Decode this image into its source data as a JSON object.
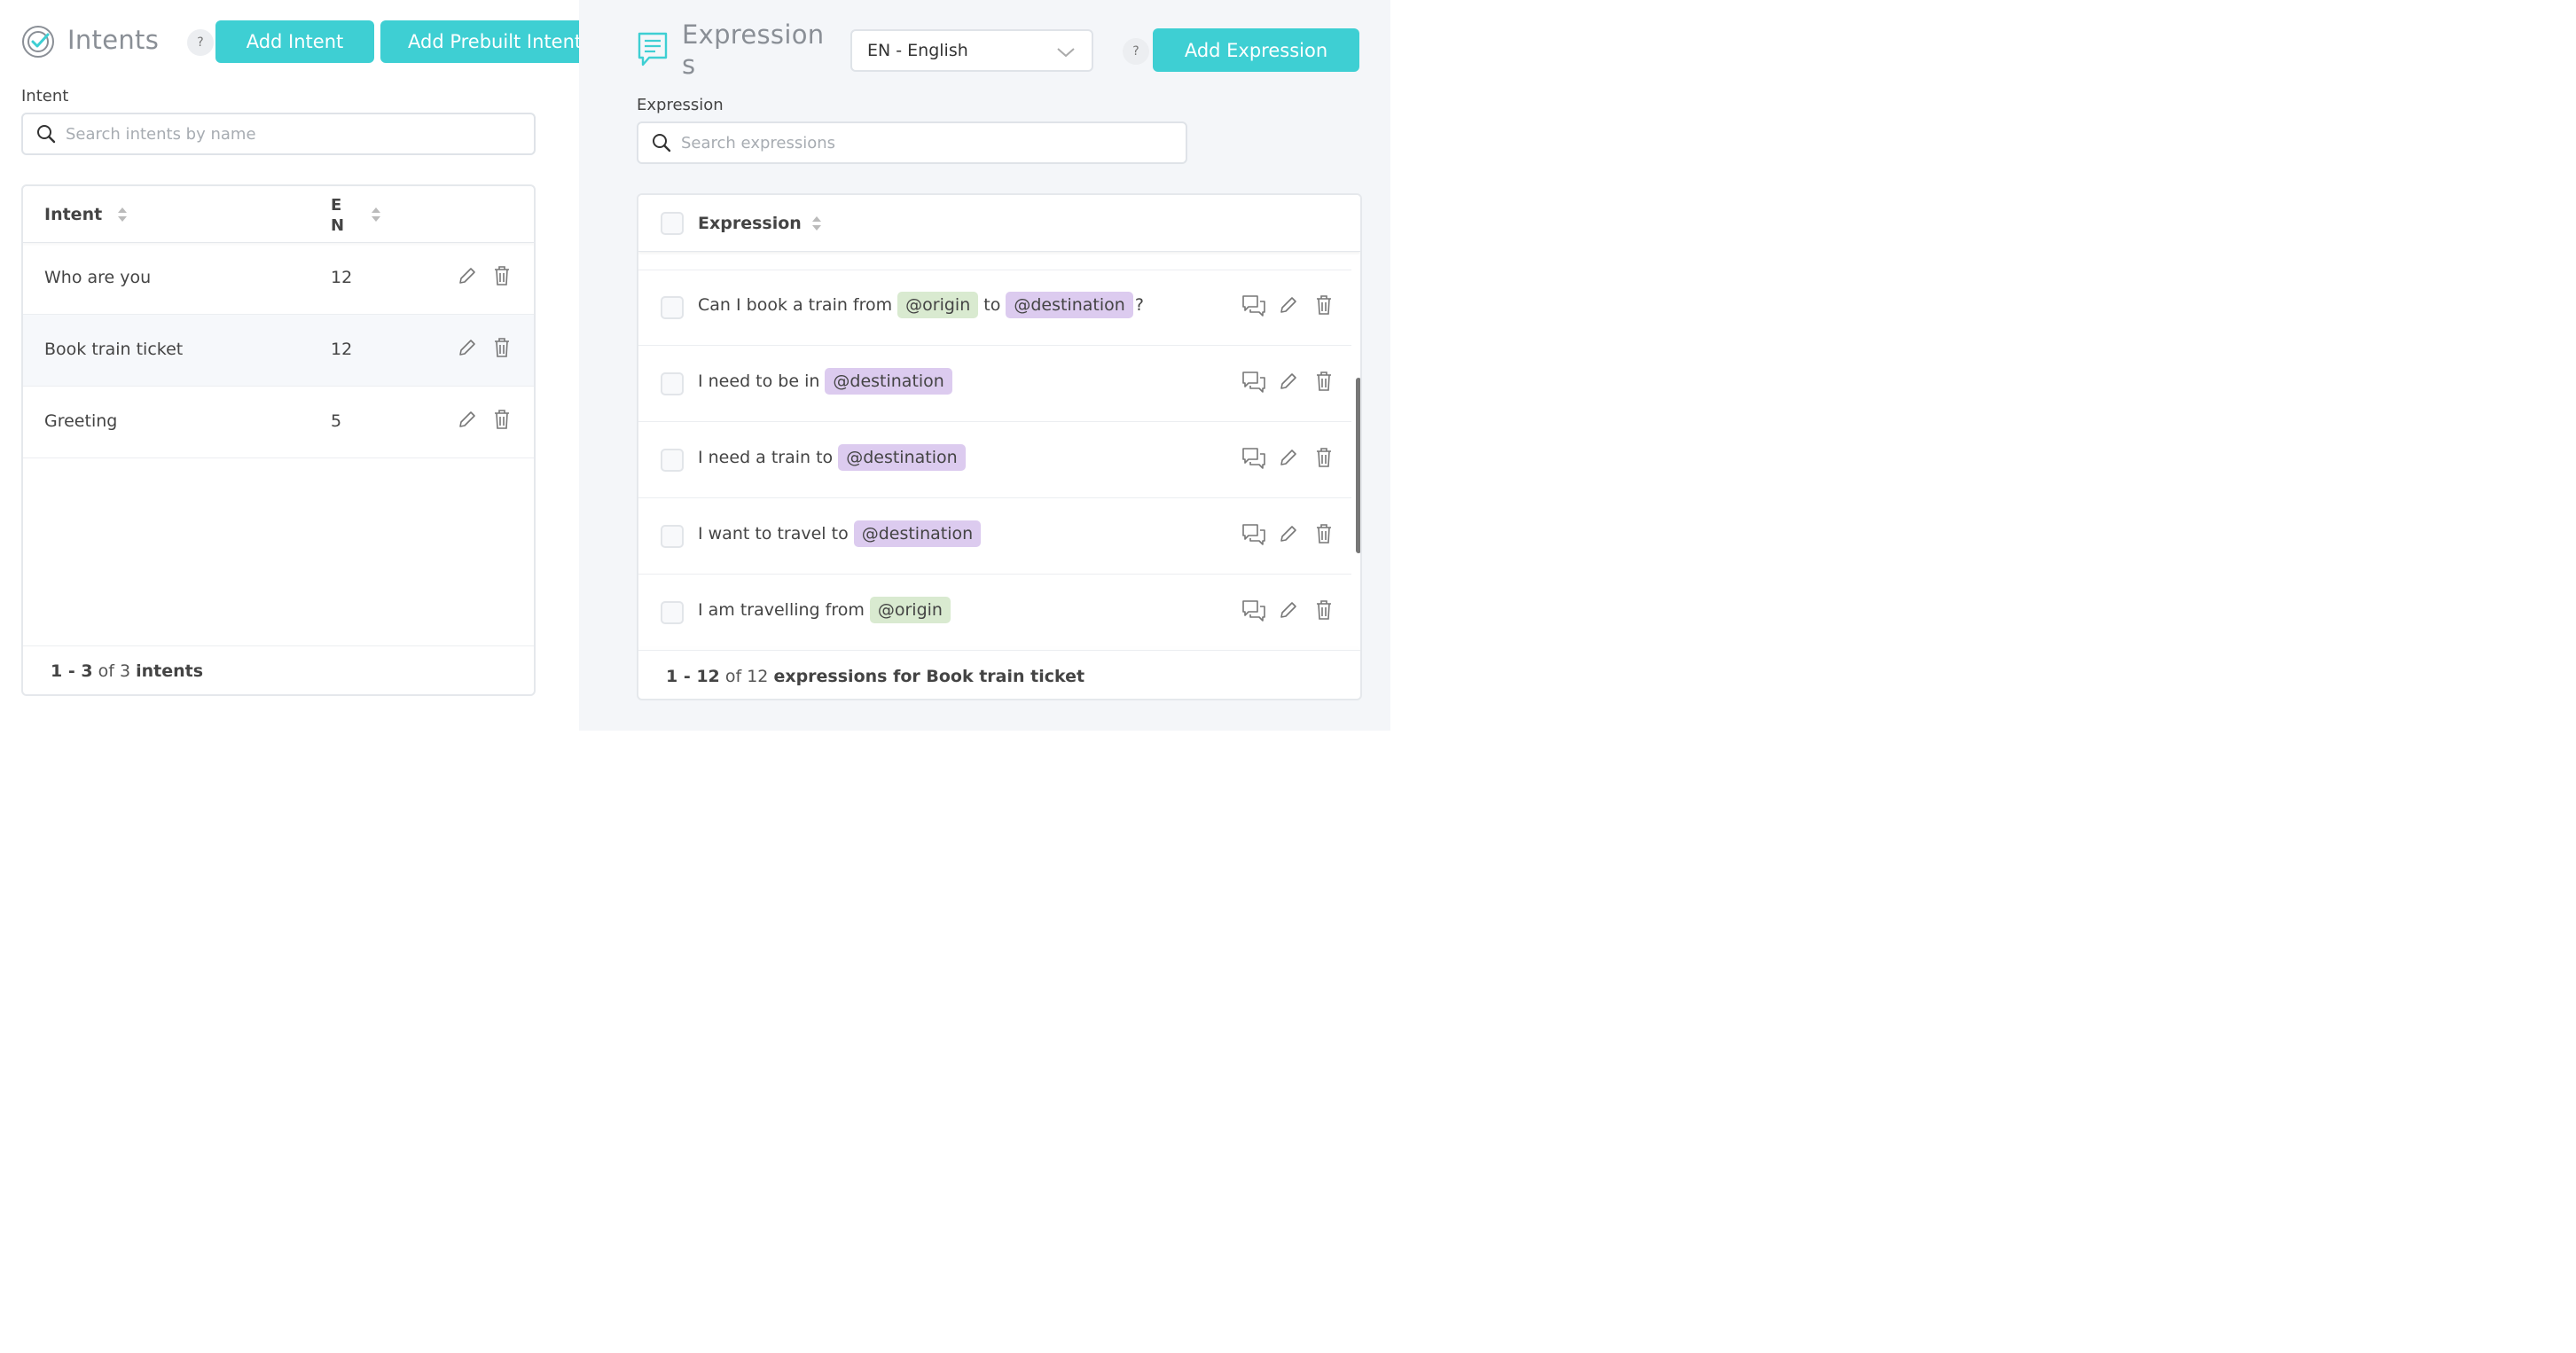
{
  "intents": {
    "title": "Intents",
    "help": "?",
    "add_intent_label": "Add Intent",
    "add_prebuilt_label": "Add Prebuilt Intent",
    "field_label": "Intent",
    "search_placeholder": "Search intents by name",
    "table": {
      "col_intent": "Intent",
      "col_lang_1": "E",
      "col_lang_2": "N",
      "rows": [
        {
          "name": "Who are you",
          "count": "12"
        },
        {
          "name": "Book train ticket",
          "count": "12"
        },
        {
          "name": "Greeting",
          "count": "5"
        }
      ]
    },
    "footer": {
      "range": "1 - 3",
      "of": "of",
      "total": "3",
      "unit": "intents"
    }
  },
  "expressions": {
    "title_line1": "Expression",
    "title_line2": "s",
    "language": "EN - English",
    "help": "?",
    "add_label": "Add Expression",
    "field_label": "Expression",
    "search_placeholder": "Search expressions",
    "col_expression": "Expression",
    "rows": [
      {
        "parts": [
          {
            "t": "Can I book a train from"
          },
          {
            "tag": "@origin",
            "kind": "origin"
          },
          {
            "t": "to"
          },
          {
            "tag": "@destination",
            "kind": "dest"
          },
          {
            "t": "?"
          }
        ]
      },
      {
        "parts": [
          {
            "t": "I need to be in"
          },
          {
            "tag": "@destination",
            "kind": "dest"
          }
        ]
      },
      {
        "parts": [
          {
            "t": "I need a train to"
          },
          {
            "tag": "@destination",
            "kind": "dest"
          }
        ]
      },
      {
        "parts": [
          {
            "t": "I want to travel to"
          },
          {
            "tag": "@destination",
            "kind": "dest"
          }
        ]
      },
      {
        "parts": [
          {
            "t": "I am travelling from"
          },
          {
            "tag": "@origin",
            "kind": "origin"
          }
        ]
      }
    ],
    "footer": {
      "range": "1 - 12",
      "of": "of",
      "total": "12",
      "suffix": "expressions for Book train ticket"
    }
  },
  "colors": {
    "accent": "#3ecfd3",
    "origin_tag": "#d9ead0",
    "destination_tag": "#dccbef"
  }
}
